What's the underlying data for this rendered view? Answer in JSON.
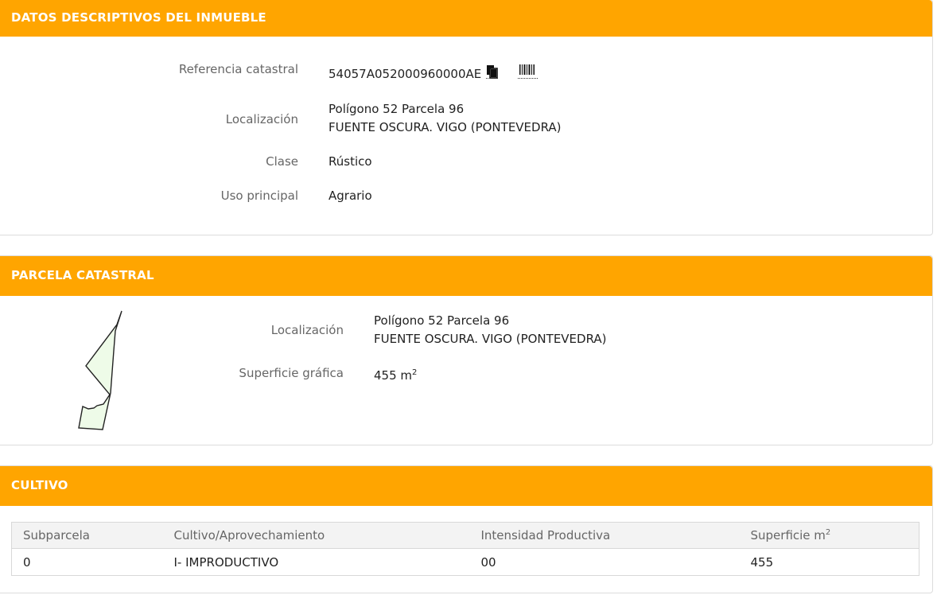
{
  "inmueble": {
    "header": "DATOS DESCRIPTIVOS DEL INMUEBLE",
    "ref_label": "Referencia catastral",
    "ref_value": "54057A052000960000AE",
    "loc_label": "Localización",
    "loc_line1": "Polígono 52 Parcela 96",
    "loc_line2": "FUENTE OSCURA. VIGO (PONTEVEDRA)",
    "clase_label": "Clase",
    "clase_value": "Rústico",
    "uso_label": "Uso principal",
    "uso_value": "Agrario"
  },
  "parcela": {
    "header": "PARCELA CATASTRAL",
    "loc_label": "Localización",
    "loc_line1": "Polígono 52 Parcela 96",
    "loc_line2": "FUENTE OSCURA. VIGO (PONTEVEDRA)",
    "sup_label": "Superficie gráfica",
    "sup_value": "455 m",
    "sup_unit_exp": "2"
  },
  "cultivo": {
    "header": "CULTIVO",
    "columns": [
      "Subparcela",
      "Cultivo/Aprovechamiento",
      "Intensidad Productiva",
      "Superficie m"
    ],
    "col4_exp": "2",
    "rows": [
      [
        "0",
        "I- IMPRODUCTIVO",
        "00",
        "455"
      ]
    ]
  },
  "colors": {
    "header_bg": "#ffa500",
    "parcel_fill": "#eefbe8"
  },
  "icons": [
    "copy-icon",
    "barcode-icon"
  ]
}
